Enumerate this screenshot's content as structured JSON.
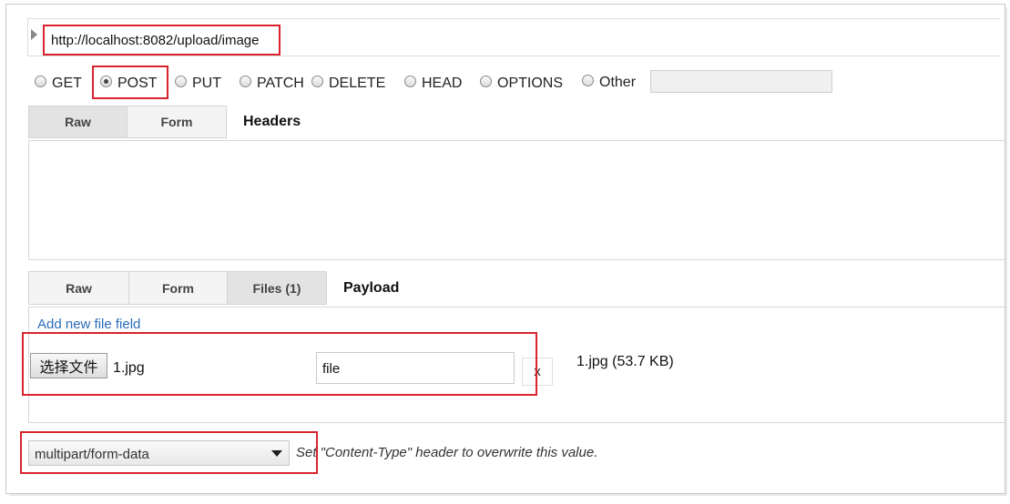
{
  "request": {
    "url": "http://localhost:8082/upload/image",
    "methods": [
      {
        "label": "GET",
        "checked": false
      },
      {
        "label": "POST",
        "checked": true
      },
      {
        "label": "PUT",
        "checked": false
      },
      {
        "label": "PATCH",
        "checked": false
      },
      {
        "label": "DELETE",
        "checked": false
      },
      {
        "label": "HEAD",
        "checked": false
      },
      {
        "label": "OPTIONS",
        "checked": false
      },
      {
        "label": "Other",
        "checked": false
      }
    ],
    "other_value": ""
  },
  "headers": {
    "tabs": [
      "Raw",
      "Form"
    ],
    "title": "Headers",
    "content": ""
  },
  "payload": {
    "tabs": [
      "Raw",
      "Form",
      "Files (1)"
    ],
    "title": "Payload",
    "add_field_link": "Add new file field",
    "choose_button": "选择文件",
    "chosen_file": "1.jpg",
    "field_name": "file",
    "remove_label": "x",
    "file_info": "1.jpg (53.7 KB)"
  },
  "encoding": {
    "selected": "multipart/form-data",
    "hint": "Set \"Content-Type\" header to overwrite this value."
  },
  "colors": {
    "highlight": "#d9232d",
    "link": "#2a6db8"
  }
}
